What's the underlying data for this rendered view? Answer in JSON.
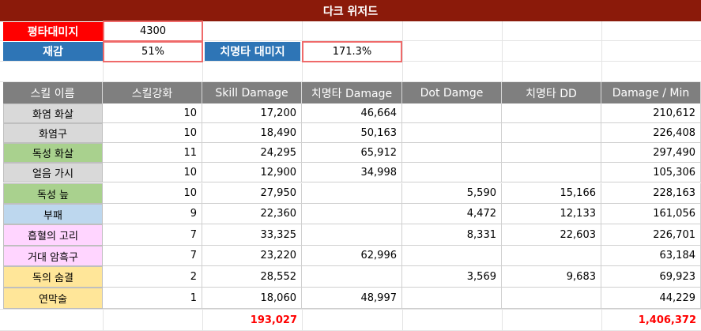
{
  "title": "다크 위저드",
  "info": {
    "base_damage_label": "평타대미지",
    "base_damage_value": "4300",
    "reduction_label": "재감",
    "reduction_value": "51%",
    "crit_label": "치명타 대미지",
    "crit_value": "171.3%"
  },
  "colors": {
    "title_bg": "#8b1a0a",
    "base_label_bg": "#ff0000",
    "blue_label_bg": "#2e75b6",
    "header_bg": "#7f7f7f",
    "highlight_border": "#ef6a6a",
    "total_text": "#ff0000"
  },
  "headers": [
    "스킬 이름",
    "스킬강화",
    "Skill Damage",
    "치명타 Damage",
    "Dot Damge",
    "치명타 DD",
    "Damage / Min"
  ],
  "rows": [
    {
      "name": "화염 화살",
      "color": "#d9d9d9",
      "cells": [
        "10",
        "17,200",
        "46,664",
        "",
        "",
        "210,612"
      ]
    },
    {
      "name": "화염구",
      "color": "#d9d9d9",
      "cells": [
        "10",
        "18,490",
        "50,163",
        "",
        "",
        "226,408"
      ]
    },
    {
      "name": "독성 화살",
      "color": "#a9d18e",
      "cells": [
        "11",
        "24,295",
        "65,912",
        "",
        "",
        "297,490"
      ]
    },
    {
      "name": "얼음 가시",
      "color": "#d9d9d9",
      "cells": [
        "10",
        "12,900",
        "34,998",
        "",
        "",
        "105,306"
      ]
    },
    {
      "name": "독성 늪",
      "color": "#a9d18e",
      "cells": [
        "10",
        "27,950",
        "",
        "5,590",
        "15,166",
        "228,163"
      ]
    },
    {
      "name": "부패",
      "color": "#bdd7ee",
      "cells": [
        "9",
        "22,360",
        "",
        "4,472",
        "12,133",
        "161,056"
      ]
    },
    {
      "name": "흡혈의 고리",
      "color": "#ffd5ff",
      "cells": [
        "7",
        "33,325",
        "",
        "8,331",
        "22,603",
        "226,701"
      ]
    },
    {
      "name": "거대 암흑구",
      "color": "#ffd5ff",
      "cells": [
        "7",
        "23,220",
        "62,996",
        "",
        "",
        "63,184"
      ]
    },
    {
      "name": "독의 숨결",
      "color": "#ffe699",
      "cells": [
        "2",
        "28,552",
        "",
        "3,569",
        "9,683",
        "69,923"
      ]
    },
    {
      "name": "연막술",
      "color": "#ffe699",
      "cells": [
        "1",
        "18,060",
        "48,997",
        "",
        "",
        "44,229"
      ]
    }
  ],
  "totals": {
    "skill_damage": "193,027",
    "damage_per_min": "1,406,372"
  }
}
